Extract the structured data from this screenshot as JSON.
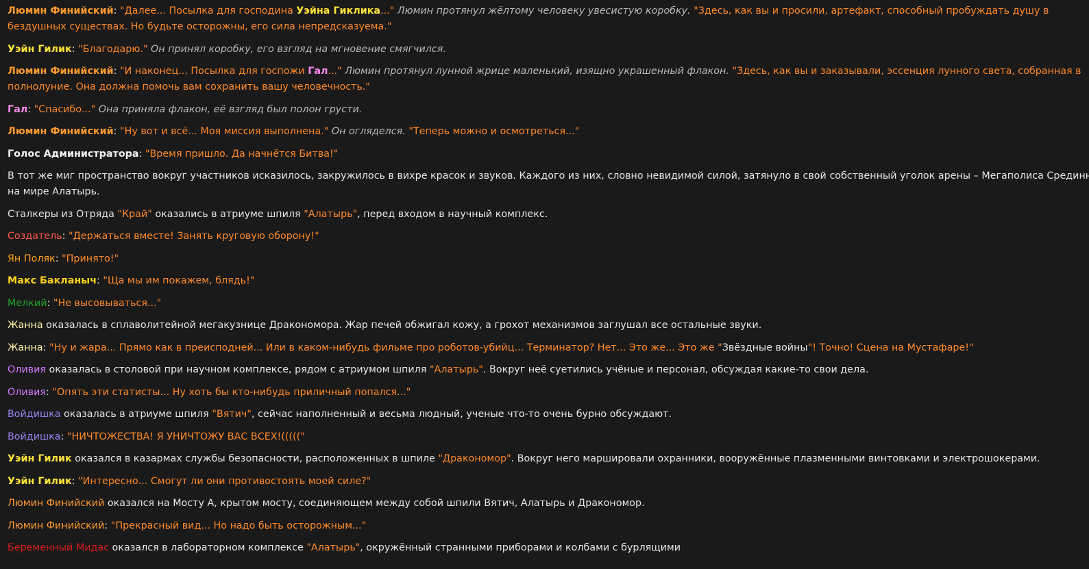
{
  "colors": {
    "background": "#1a1a1a",
    "text": "#e6e6e6",
    "quote": "#ff8a2a",
    "narration_italic": "#b9b9b9",
    "lumin": "#ff9a2e",
    "wayne": "#ffe23d",
    "gal": "#ff88ee",
    "admin": "#f2f2f2",
    "creator": "#ff5a4a",
    "yan": "#ffa21f",
    "maks": "#ffd21a",
    "melkiy": "#1fa52a",
    "zhanna": "#fff2a8",
    "olivia": "#d27bff",
    "voidishka": "#9a82f0",
    "midas": "#d91d1d"
  },
  "lines": [
    {
      "speaker": "Люмин Финийский",
      "sep": ": ",
      "q1a": "\"Далее... Посылка для господина ",
      "q1name": "Уэйна Гиклика",
      "q1b": "...\"",
      "action": " Люмин протянул жёлтому человеку увесистую коробку. ",
      "q2": "\"Здесь, как вы и просили, артефакт, способный пробуждать душу в бездушных существах. Но будьте осторожны, его сила непредсказуема.\""
    },
    {
      "speaker": "Уэйн Гилик",
      "sep": ": ",
      "q1": "\"Благодарю.\"",
      "action": " Он принял коробку, его взгляд на мгновение смягчился."
    },
    {
      "speaker": "Люмин Финийский",
      "sep": ": ",
      "q1a": "\"И наконец... Посылка для госпожи ",
      "q1name": "Гал",
      "q1b": "...\"",
      "action": " Люмин протянул лунной жрице маленький, изящно украшенный флакон. ",
      "q2": "\"Здесь, как вы и заказывали, эссенция лунного света, собранная в полнолуние. Она должна помочь вам сохранить вашу человечность.\""
    },
    {
      "speaker": "Гал",
      "sep": ": ",
      "q1": "\"Спасибо...\"",
      "action": " Она приняла флакон, её взгляд был полон грусти."
    },
    {
      "speaker": "Люмин Финийский",
      "sep": ": ",
      "q1": "\"Ну вот и всё... Моя миссия выполнена.\"",
      "action": " Он огляделся. ",
      "q2": "\"Теперь можно и осмотреться...\""
    },
    {
      "speaker": "Голос Администратора",
      "sep": ": ",
      "q1": "\"Время пришло. Да начнётся Битва!\""
    },
    {
      "text": "В тот же миг пространство вокруг участников исказилось, закружилось в вихре красок и звуков. Каждого из них, словно невидимой силой, затянуло в свой собственный уголок арены – Мегаполиса Срединного",
      "text2": "на мире Алатырь."
    },
    {
      "t1": "Сталкеры из Отряда ",
      "p1": "\"Край\"",
      "t2": " оказались в атриуме шпиля ",
      "p2": "\"Алатырь\"",
      "t3": ", перед входом в научный комплекс."
    },
    {
      "speaker": "Создатель",
      "sep": ": ",
      "q1": "\"Держаться вместе! Занять круговую оборону!\""
    },
    {
      "speaker": "Ян Поляк",
      "sep": ": ",
      "q1": "\"Принято!\""
    },
    {
      "speaker": "Макс Бакланыч",
      "sep": ": ",
      "q1": "\"Ща мы им покажем, блядь!\""
    },
    {
      "speaker": "Мелкий",
      "sep": ": ",
      "q1": "\"Не высовываться...\""
    },
    {
      "speaker": "Жанна",
      "text": " оказалась в сплаволитейной мегакузнице Дракономора. Жар печей обжигал кожу, а грохот механизмов заглушал все остальные звуки."
    },
    {
      "speaker": "Жанна",
      "sep": ": ",
      "q1a": "\"Ну и жара... Прямо как в преисподней... Или в каком-нибудь фильме про роботов-убийц... Терминатор? Нет... Это же... Это же \"",
      "title": "Звёздные войны",
      "q1b": "\"! Точно! Сцена на Мустафаре!\""
    },
    {
      "speaker": "Оливия",
      "t1": " оказалась в столовой при научном комплексе, рядом с атриумом шпиля ",
      "p1": "\"Алатырь\"",
      "t2": ". Вокруг неё суетились учёные и персонал, обсуждая какие-то свои дела."
    },
    {
      "speaker": "Оливия",
      "sep": ": ",
      "q1": "\"Опять эти статисты... Ну хоть бы кто-нибудь приличный попался...\""
    },
    {
      "speaker": "Войдишка",
      "t1": " оказалась в атриуме шпиля ",
      "p1": "\"Вятич\"",
      "t2": ", сейчас наполненный и весьма людный, ученые что-то очень бурно обсуждают."
    },
    {
      "speaker": "Войдишка",
      "sep": ": ",
      "q1": "\"НИЧТОЖЕСТВА! Я УНИЧТОЖУ ВАС ВСЕХ!(((((\""
    },
    {
      "speaker": "Уэйн Гилик",
      "t1": " оказался в казармах службы безопасности, расположенных в шпиле ",
      "p1": "\"Дракономор\"",
      "t2": ". Вокруг него маршировали охранники, вооружённые плазменными винтовками и электрошокерами."
    },
    {
      "speaker": "Уэйн Гилик",
      "sep": ": ",
      "q1": "\"Интересно... Смогут ли они противостоять моей силе?\""
    },
    {
      "speaker": "Люмин Финийский",
      "text": " оказался на Мосту А, крытом мосту, соединяющем между собой шпили Вятич, Алатырь и Дракономор."
    },
    {
      "speaker": "Люмин Финийский",
      "sep": ": ",
      "q1": "\"Прекрасный вид... Но надо быть осторожным...\""
    },
    {
      "speaker": "Беременный Мидас",
      "t1": " оказался в лабораторном комплексе ",
      "p1": "\"Алатырь\"",
      "t2": ", окружённый странными приборами и колбами с бурлящими"
    }
  ]
}
